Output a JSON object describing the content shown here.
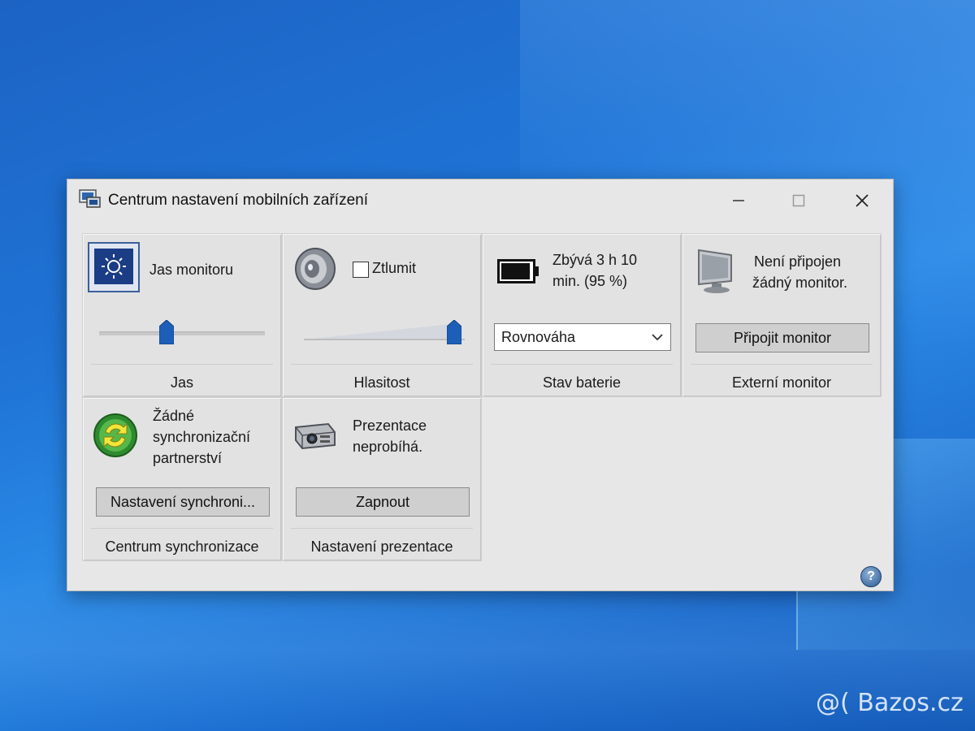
{
  "window": {
    "title": "Centrum nastavení mobilních zařízení",
    "controls": {
      "minimize": "—",
      "maximize": "☐",
      "close": "✕"
    }
  },
  "tiles": {
    "brightness": {
      "title": "Jas monitoru",
      "label": "Jas",
      "level": 0.4
    },
    "volume": {
      "mute_label": "Ztlumit",
      "mute_checked": false,
      "label": "Hlasitost",
      "level": 1.0
    },
    "battery": {
      "status_line1": "Zbývá 3 h 10",
      "status_line2": "min. (95 %)",
      "plan_selected": "Rovnováha",
      "label": "Stav baterie",
      "charge": 0.95
    },
    "external_monitor": {
      "status_line1": "Není připojen",
      "status_line2": "žádný monitor.",
      "button": "Připojit monitor",
      "label": "Externí monitor"
    },
    "sync": {
      "status_line1": "Žádné",
      "status_line2": "synchronizační",
      "status_line3": "partnerství",
      "button": "Nastavení synchroni...",
      "label": "Centrum synchronizace"
    },
    "presentation": {
      "status_line1": "Prezentace",
      "status_line2": "neprobíhá.",
      "button": "Zapnout",
      "label": "Nastavení prezentace"
    }
  },
  "help": {
    "glyph": "?"
  },
  "watermark": {
    "text": "@( Bazos.cz"
  },
  "colors": {
    "window_bg": "#e7e7e7",
    "tile_bg": "#e2e2e2",
    "slider_thumb": "#1d5fb8",
    "desktop": "#1f74d6"
  }
}
